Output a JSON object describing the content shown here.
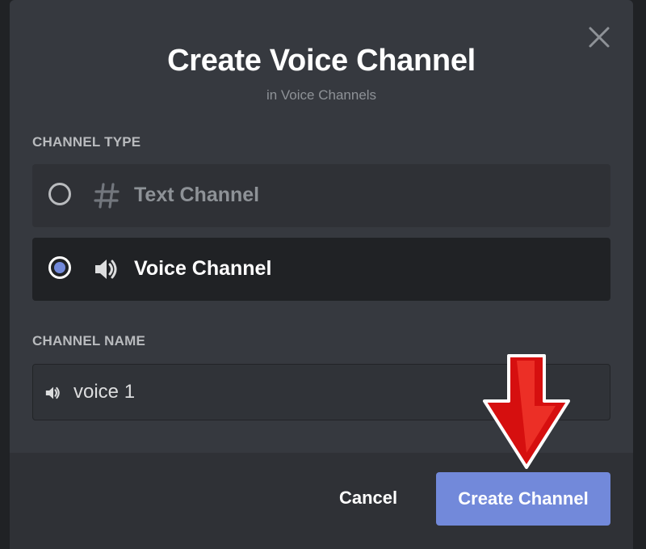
{
  "dialog": {
    "title": "Create Voice Channel",
    "subtitle": "in Voice Channels"
  },
  "channel_type": {
    "label": "CHANNEL TYPE",
    "options": [
      {
        "label": "Text Channel",
        "icon": "hash-icon",
        "selected": false
      },
      {
        "label": "Voice Channel",
        "icon": "speaker-icon",
        "selected": true
      }
    ]
  },
  "channel_name": {
    "label": "CHANNEL NAME",
    "value": "voice 1",
    "icon": "speaker-icon"
  },
  "footer": {
    "cancel_label": "Cancel",
    "create_label": "Create Channel"
  },
  "colors": {
    "modal_bg": "#36393f",
    "footer_bg": "#2f3136",
    "accent": "#7289da",
    "annotation_arrow": "#e01010"
  }
}
